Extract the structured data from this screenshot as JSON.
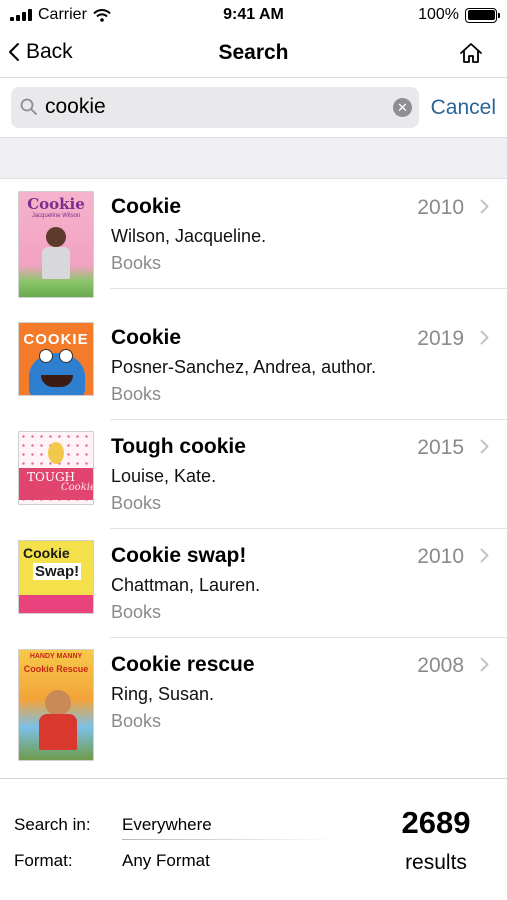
{
  "status_bar": {
    "carrier": "Carrier",
    "time": "9:41 AM",
    "battery": "100%"
  },
  "nav": {
    "back_label": "Back",
    "title": "Search",
    "home_icon": "home-icon"
  },
  "search": {
    "value": "cookie",
    "cancel_label": "Cancel"
  },
  "results": [
    {
      "title": "Cookie",
      "author": "Wilson, Jacqueline.",
      "format": "Books",
      "year": "2010",
      "cover_text": "Cookie",
      "cover_sub": "Jacqueline Wilson"
    },
    {
      "title": "Cookie",
      "author": "Posner-Sanchez, Andrea, author.",
      "format": "Books",
      "year": "2019",
      "cover_text": "COOKIE"
    },
    {
      "title": "Tough cookie",
      "author": "Louise, Kate.",
      "format": "Books",
      "year": "2015",
      "cover_text": "TOUGH",
      "cover_sub": "Cookie"
    },
    {
      "title": "Cookie swap!",
      "author": "Chattman, Lauren.",
      "format": "Books",
      "year": "2010",
      "cover_text": "Cookie",
      "cover_sub": "Swap!"
    },
    {
      "title": "Cookie rescue",
      "author": "Ring, Susan.",
      "format": "Books",
      "year": "2008",
      "cover_text": "HANDY MANNY",
      "cover_sub": "Cookie Rescue"
    }
  ],
  "footer": {
    "search_in_label": "Search in:",
    "search_in_value": "Everywhere",
    "format_label": "Format:",
    "format_value": "Any Format",
    "count": "2689",
    "count_label": "results"
  },
  "colors": {
    "accent": "#2a6598",
    "secondary_text": "#8a8a8e",
    "band": "#efeff4"
  }
}
